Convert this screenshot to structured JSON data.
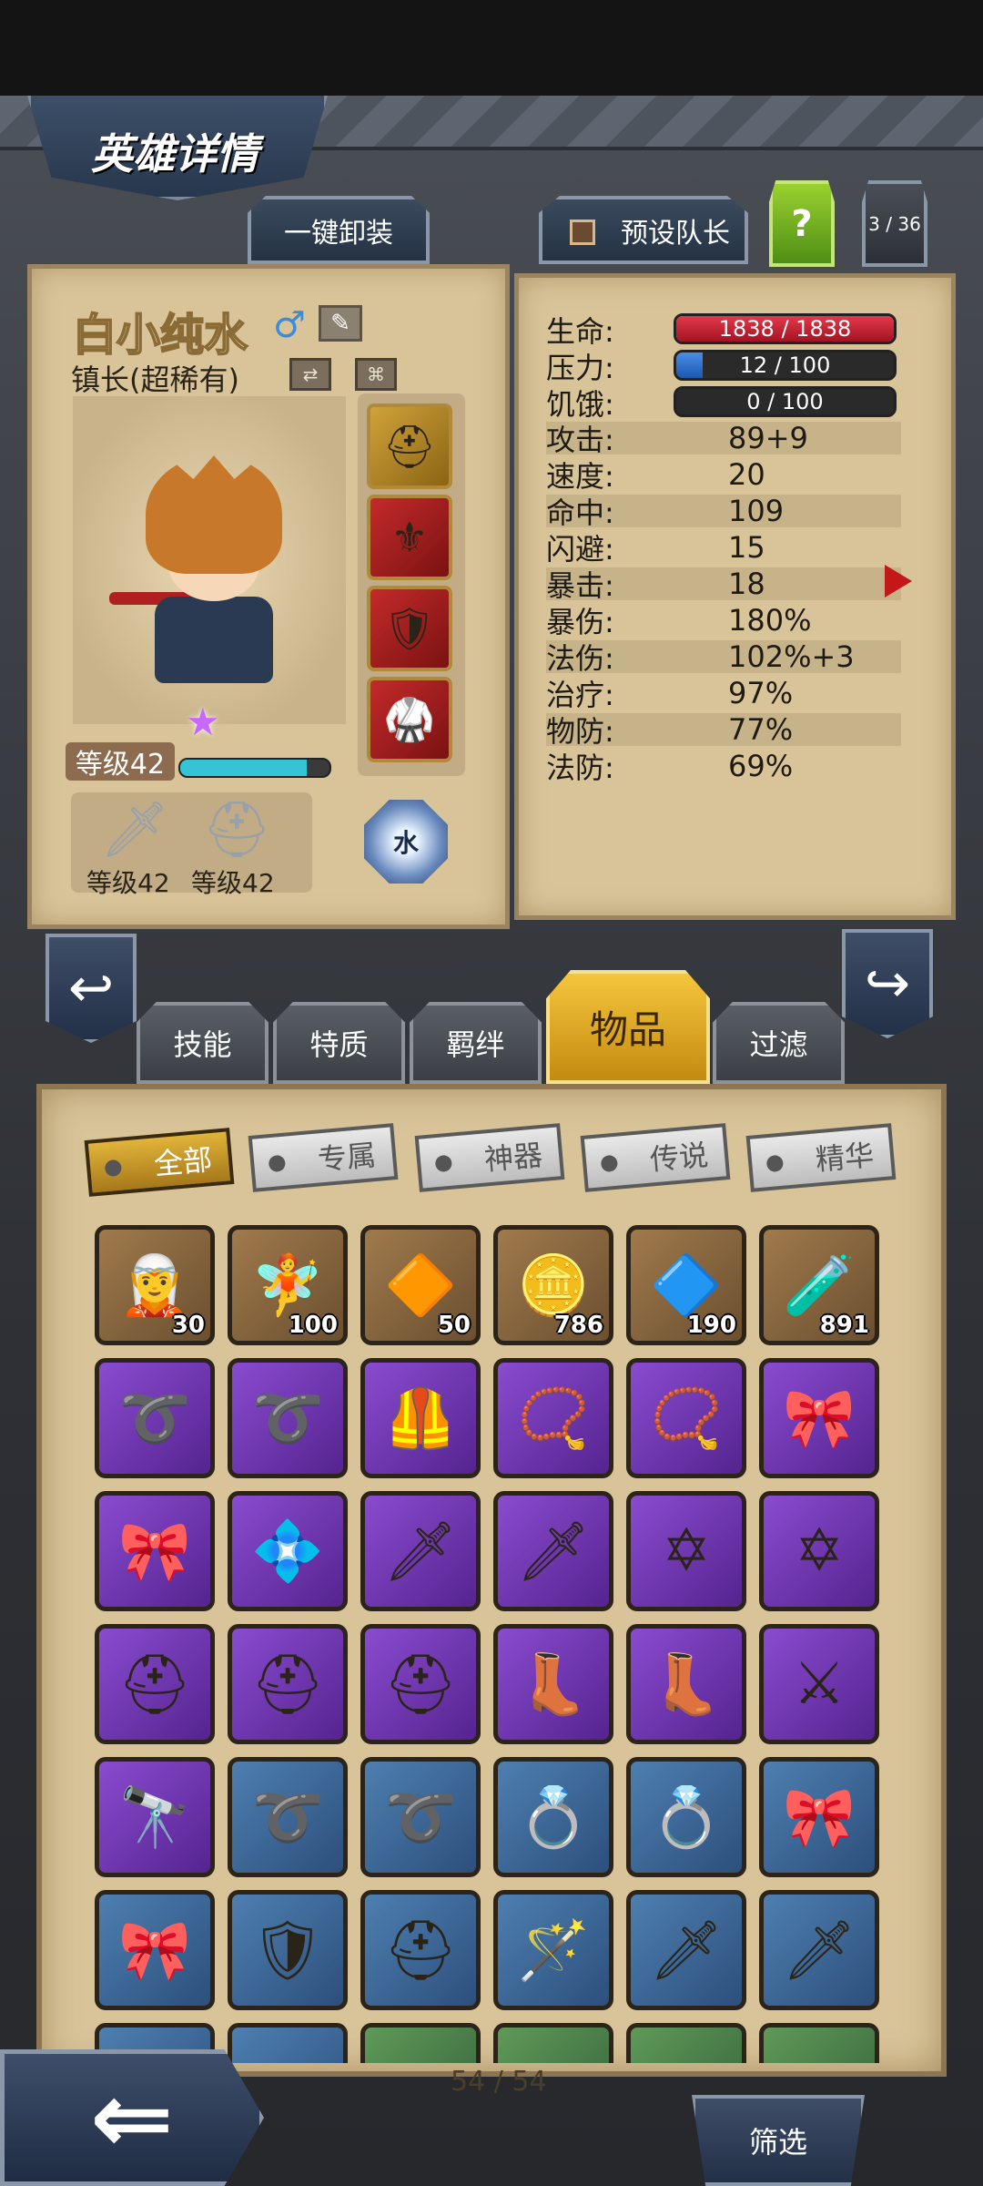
{
  "header": {
    "title": "英雄详情"
  },
  "top_buttons": {
    "unequip_all": "一键卸装",
    "preset_leader": "预设队长",
    "help": "?",
    "hero_index": "3 / 36"
  },
  "hero": {
    "name": "白小纯水",
    "gender_symbol": "♂",
    "title": "镇长(超稀有)",
    "level_label": "等级42",
    "xp_fraction": 0.85,
    "element": "水",
    "weapon_level": "等级42",
    "armor_level": "等级42",
    "equipped": [
      {
        "icon": "helmet-icon",
        "glyph": "⛑"
      },
      {
        "icon": "winged-helm-icon",
        "glyph": "⚜"
      },
      {
        "icon": "shield-sword-icon",
        "glyph": "🛡"
      },
      {
        "icon": "armor-icon",
        "glyph": "🥋"
      }
    ]
  },
  "stats": {
    "hp_label": "生命:",
    "hp_value": "1838 / 1838",
    "hp_fraction": 1.0,
    "stress_label": "压力:",
    "stress_value": "12 / 100",
    "stress_fraction": 0.12,
    "hunger_label": "饥饿:",
    "hunger_value": "0 / 100",
    "hunger_fraction": 0.0,
    "rows": [
      {
        "label": "攻击:",
        "value": "89+9"
      },
      {
        "label": "速度:",
        "value": "20"
      },
      {
        "label": "命中:",
        "value": "109"
      },
      {
        "label": "闪避:",
        "value": "15"
      },
      {
        "label": "暴击:",
        "value": "18"
      },
      {
        "label": "暴伤:",
        "value": "180%"
      },
      {
        "label": "法伤:",
        "value": "102%+3"
      },
      {
        "label": "治疗:",
        "value": "97%"
      },
      {
        "label": "物防:",
        "value": "77%"
      },
      {
        "label": "法防:",
        "value": "69%"
      }
    ]
  },
  "content_tabs": [
    "技能",
    "特质",
    "羁绊",
    "物品",
    "过滤"
  ],
  "active_tab": "物品",
  "filters": [
    "全部",
    "专属",
    "神器",
    "传说",
    "精华"
  ],
  "inventory": {
    "rows": [
      [
        {
          "r": "brown",
          "g": "🧝",
          "q": "30"
        },
        {
          "r": "brown",
          "g": "🧚",
          "q": "100"
        },
        {
          "r": "brown",
          "g": "🔶",
          "q": "50"
        },
        {
          "r": "brown",
          "g": "🪙",
          "q": "786"
        },
        {
          "r": "brown",
          "g": "🔷",
          "q": "190"
        },
        {
          "r": "brown",
          "g": "🧪",
          "q": "891"
        }
      ],
      [
        {
          "r": "purple",
          "g": "➰"
        },
        {
          "r": "purple",
          "g": "➰"
        },
        {
          "r": "purple",
          "g": "🦺"
        },
        {
          "r": "purple",
          "g": "📿"
        },
        {
          "r": "purple",
          "g": "📿"
        },
        {
          "r": "purple",
          "g": "🎀"
        }
      ],
      [
        {
          "r": "purple",
          "g": "🎀"
        },
        {
          "r": "purple",
          "g": "💠"
        },
        {
          "r": "purple",
          "g": "🗡"
        },
        {
          "r": "purple",
          "g": "🗡"
        },
        {
          "r": "purple",
          "g": "✡"
        },
        {
          "r": "purple",
          "g": "✡"
        }
      ],
      [
        {
          "r": "purple",
          "g": "⛑"
        },
        {
          "r": "purple",
          "g": "⛑"
        },
        {
          "r": "purple",
          "g": "⛑"
        },
        {
          "r": "purple",
          "g": "👢"
        },
        {
          "r": "purple",
          "g": "👢"
        },
        {
          "r": "purple",
          "g": "⚔"
        }
      ],
      [
        {
          "r": "purple",
          "g": "🔭"
        },
        {
          "r": "blue",
          "g": "➰"
        },
        {
          "r": "blue",
          "g": "➰"
        },
        {
          "r": "blue",
          "g": "💍"
        },
        {
          "r": "blue",
          "g": "💍"
        },
        {
          "r": "blue",
          "g": "🎀"
        }
      ],
      [
        {
          "r": "blue",
          "g": "🎀"
        },
        {
          "r": "blue",
          "g": "🛡"
        },
        {
          "r": "blue",
          "g": "⛑"
        },
        {
          "r": "blue",
          "g": "🪄"
        },
        {
          "r": "blue",
          "g": "🗡"
        },
        {
          "r": "blue",
          "g": "🗡"
        }
      ],
      [
        {
          "r": "blue",
          "g": ""
        },
        {
          "r": "blue",
          "g": ""
        },
        {
          "r": "green",
          "g": ""
        },
        {
          "r": "green",
          "g": ""
        },
        {
          "r": "green",
          "g": ""
        },
        {
          "r": "green",
          "g": ""
        }
      ]
    ],
    "page_count": "54 / 54"
  },
  "bottom": {
    "sort_label": "筛选"
  }
}
